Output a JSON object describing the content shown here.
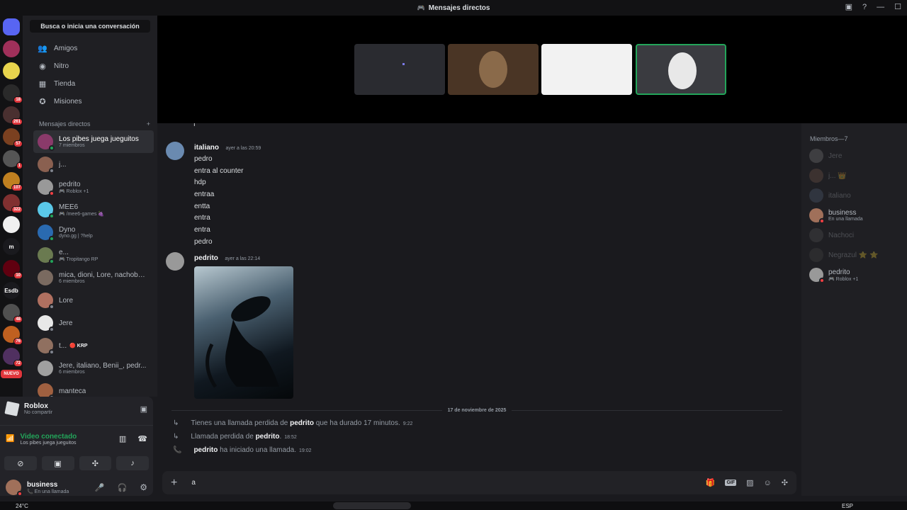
{
  "titlebar": {
    "title": "Mensajes directos"
  },
  "guilds": [
    {
      "label": "",
      "badge": "",
      "color": "#5865f2",
      "home": true
    },
    {
      "label": "",
      "badge": "",
      "color": "#a0305a"
    },
    {
      "label": "",
      "badge": "",
      "color": "#e8d44d"
    },
    {
      "label": "",
      "badge": "18",
      "color": "#2a2a2a"
    },
    {
      "label": "",
      "badge": "261",
      "color": "#4a3030"
    },
    {
      "label": "",
      "badge": "57",
      "color": "#7a4020"
    },
    {
      "label": "",
      "badge": "1",
      "color": "#555555"
    },
    {
      "label": "",
      "badge": "107",
      "color": "#c08020"
    },
    {
      "label": "",
      "badge": "322",
      "color": "#803030"
    },
    {
      "label": "",
      "badge": "",
      "color": "#f0f0f0"
    },
    {
      "label": "m",
      "badge": "",
      "color": "#1a1a1e"
    },
    {
      "label": "",
      "badge": "10",
      "color": "#600010"
    },
    {
      "label": "Esdb",
      "badge": "",
      "color": "#1a1a1e"
    },
    {
      "label": "",
      "badge": "48",
      "color": "#505050"
    },
    {
      "label": "",
      "badge": "76",
      "color": "#c06020"
    },
    {
      "label": "",
      "badge": "72",
      "color": "#503060"
    }
  ],
  "new_badge": "NUEVO",
  "sidebar": {
    "search_label": "Busca o inicia una conversación",
    "nav": [
      {
        "label": "Amigos",
        "icon": "👥"
      },
      {
        "label": "Nitro",
        "icon": "◉"
      },
      {
        "label": "Tienda",
        "icon": "▦"
      },
      {
        "label": "Misiones",
        "icon": "✪"
      }
    ],
    "dm_header": "Mensajes directos",
    "dm_add": "+",
    "dms": [
      {
        "name": "Los pibes juega jueguitos",
        "sub": "7 miembros",
        "active": true,
        "color": "#8a3a6a",
        "status": "on"
      },
      {
        "name": "j...",
        "sub": "",
        "color": "#8a6050",
        "status": "off"
      },
      {
        "name": "pedrito",
        "sub": "🎮 Roblox +1",
        "color": "#999999",
        "status": "dnd"
      },
      {
        "name": "MEE6",
        "sub": "🎮 /mee6-games 🍇",
        "color": "#5ac8e8",
        "status": "on"
      },
      {
        "name": "Dyno",
        "sub": "dyno.gg | ?help",
        "color": "#2a6ab0",
        "status": "on"
      },
      {
        "name": "e...",
        "sub": "🎮 Tropitango RP",
        "color": "#6a7a50",
        "status": "on"
      },
      {
        "name": "mica, dioni, Lore, nachobe...",
        "sub": "6 miembros",
        "color": "#7a6a60",
        "status": ""
      },
      {
        "name": "Lore",
        "sub": "",
        "color": "#b07060",
        "status": "off"
      },
      {
        "name": "Jere",
        "sub": "",
        "color": "#e8e8e8",
        "status": "off"
      },
      {
        "name": "t...",
        "sub": "",
        "tag": "🔴 KRP",
        "color": "#907060",
        "status": "off"
      },
      {
        "name": "Jere, italiano, Benii_, pedr...",
        "sub": "6 miembros",
        "color": "#a0a0a0",
        "status": ""
      },
      {
        "name": "manteca",
        "sub": "",
        "color": "#a06040",
        "status": "off"
      }
    ]
  },
  "activity": {
    "title": "Roblox",
    "sub": "No compartir"
  },
  "voice": {
    "status": "Video conectado",
    "channel": "Los pibes juega jueguitos"
  },
  "me": {
    "name": "business",
    "status": "📞 En una llamada"
  },
  "stage": {
    "tiles": [
      {
        "bg": "#2a2b30",
        "selected": false
      },
      {
        "bg": "#4a3525",
        "selected": false
      },
      {
        "bg": "#f2f2f2",
        "selected": false
      },
      {
        "bg": "#3a3b40",
        "selected": true
      }
    ]
  },
  "chat": {
    "top_fragment": "f",
    "messages": [
      {
        "author": "italiano",
        "time": "ayer a las 20:59",
        "color": "#6a8ab0",
        "lines": [
          "pedro",
          "entra al counter",
          "hdp",
          "entraa",
          "entta",
          "entra",
          "entra",
          "pedro"
        ]
      },
      {
        "author": "pedrito",
        "time": "ayer a las 22:14",
        "color": "#999999",
        "lines": []
      }
    ],
    "divider": "17 de noviembre de 2025",
    "system": [
      {
        "pre": "Tienes una llamada perdida de ",
        "who": "pedrito",
        "post": " que ha durado 17 minutos.",
        "time": "9:22",
        "icon": "↳",
        "color": "#949ba4"
      },
      {
        "pre": "Llamada perdida de ",
        "who": "pedrito",
        "post": ".",
        "time": "18:52",
        "icon": "↳",
        "color": "#949ba4"
      },
      {
        "pre": "",
        "who": "pedrito",
        "post": " ha iniciado una llamada.",
        "time": "19:02",
        "icon": "📞",
        "color": "#23a55a"
      }
    ]
  },
  "composer": {
    "value": "a"
  },
  "members": {
    "header": "Miembros—7",
    "list": [
      {
        "name": "Jere",
        "sub": "",
        "dim": true,
        "color": "#888888"
      },
      {
        "name": "j... 👑",
        "sub": "",
        "dim": true,
        "color": "#806050"
      },
      {
        "name": "italiano",
        "sub": "",
        "dim": true,
        "color": "#5a6a80"
      },
      {
        "name": "business",
        "sub": "En una llamada",
        "dim": false,
        "color": "#a0705a",
        "status": "dnd"
      },
      {
        "name": "Nachoci",
        "sub": "",
        "dim": true,
        "color": "#5a5a5a"
      },
      {
        "name": "Negrazul ⭐ ⭐",
        "sub": "",
        "dim": true,
        "color": "#4a4a4a"
      },
      {
        "name": "pedrito",
        "sub": "🎮 Roblox +1",
        "dim": false,
        "color": "#999999",
        "status": "dnd"
      }
    ]
  },
  "taskbar": {
    "weather": "24°C",
    "lang": "ESP"
  }
}
